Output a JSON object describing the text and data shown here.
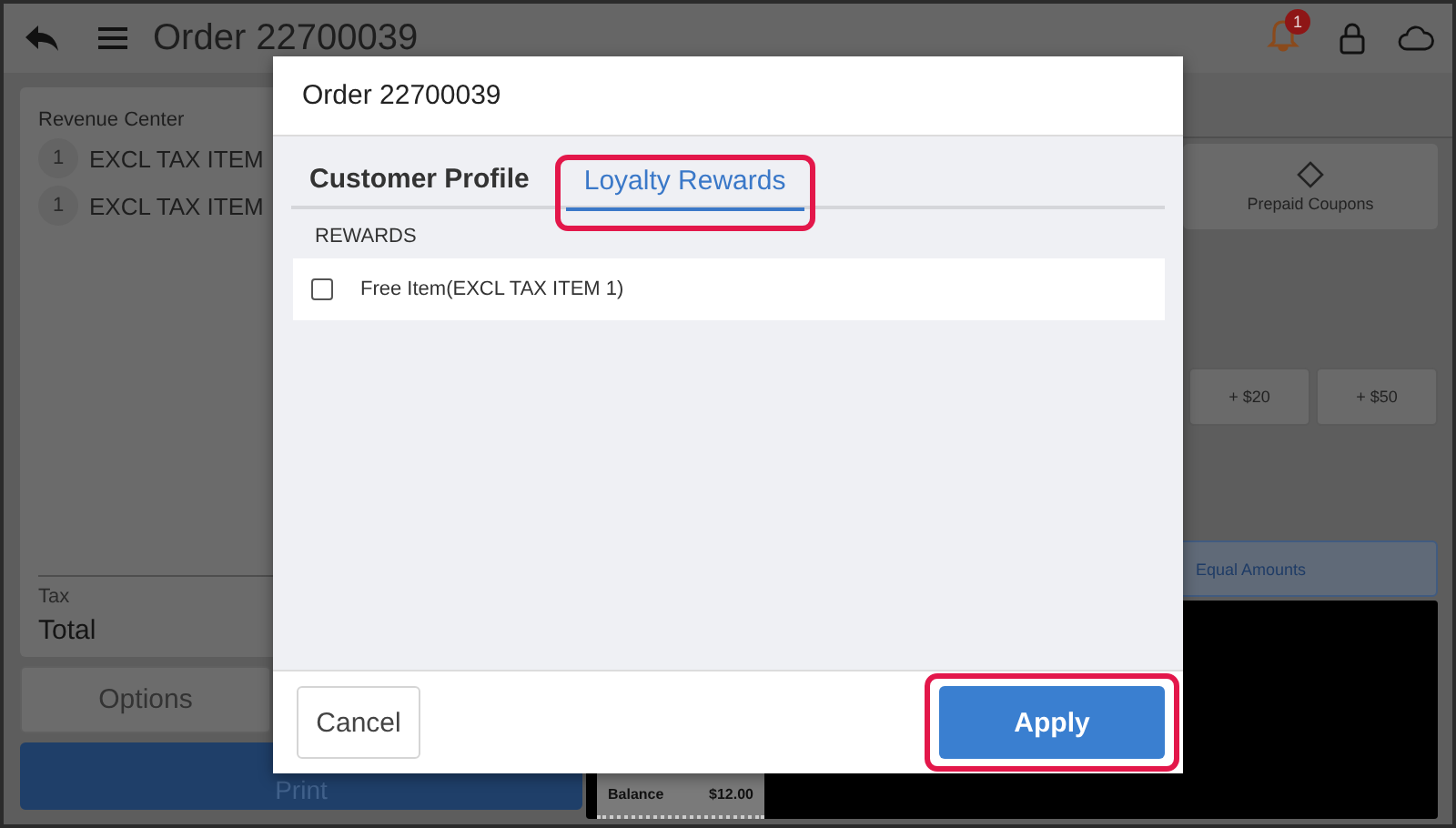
{
  "header": {
    "title": "Order 22700039",
    "notification_count": "1"
  },
  "order": {
    "label": "Revenue Center",
    "items": [
      {
        "quantity": "1",
        "name": "EXCL TAX ITEM"
      },
      {
        "quantity": "1",
        "name": "EXCL TAX ITEM"
      }
    ],
    "tax_label": "Tax",
    "total_label": "Total"
  },
  "actions": [
    {
      "label": "Options",
      "kind": "secondary"
    },
    {
      "label": "Print",
      "kind": "primary"
    }
  ],
  "payment": {
    "tiles": [
      {
        "label": "Prepaid Coupons"
      }
    ],
    "amounts": [
      "+ $20",
      "+ $50"
    ],
    "split": "Equal Amounts",
    "receipt": {
      "label": "Balance",
      "value": "$12.00"
    }
  },
  "dialog": {
    "title": "Order 22700039",
    "tabs": [
      {
        "label": "Customer Profile",
        "selected": false,
        "highlighted": false
      },
      {
        "label": "Loyalty Rewards",
        "selected": true,
        "highlighted": true
      }
    ],
    "section": "REWARDS",
    "rewards": [
      {
        "label": "Free Item(EXCL TAX ITEM 1)",
        "checked": false
      }
    ],
    "buttons": [
      {
        "label": "Cancel",
        "kind": "secondary",
        "highlighted": false
      },
      {
        "label": "Apply",
        "kind": "primary",
        "highlighted": true
      }
    ]
  }
}
